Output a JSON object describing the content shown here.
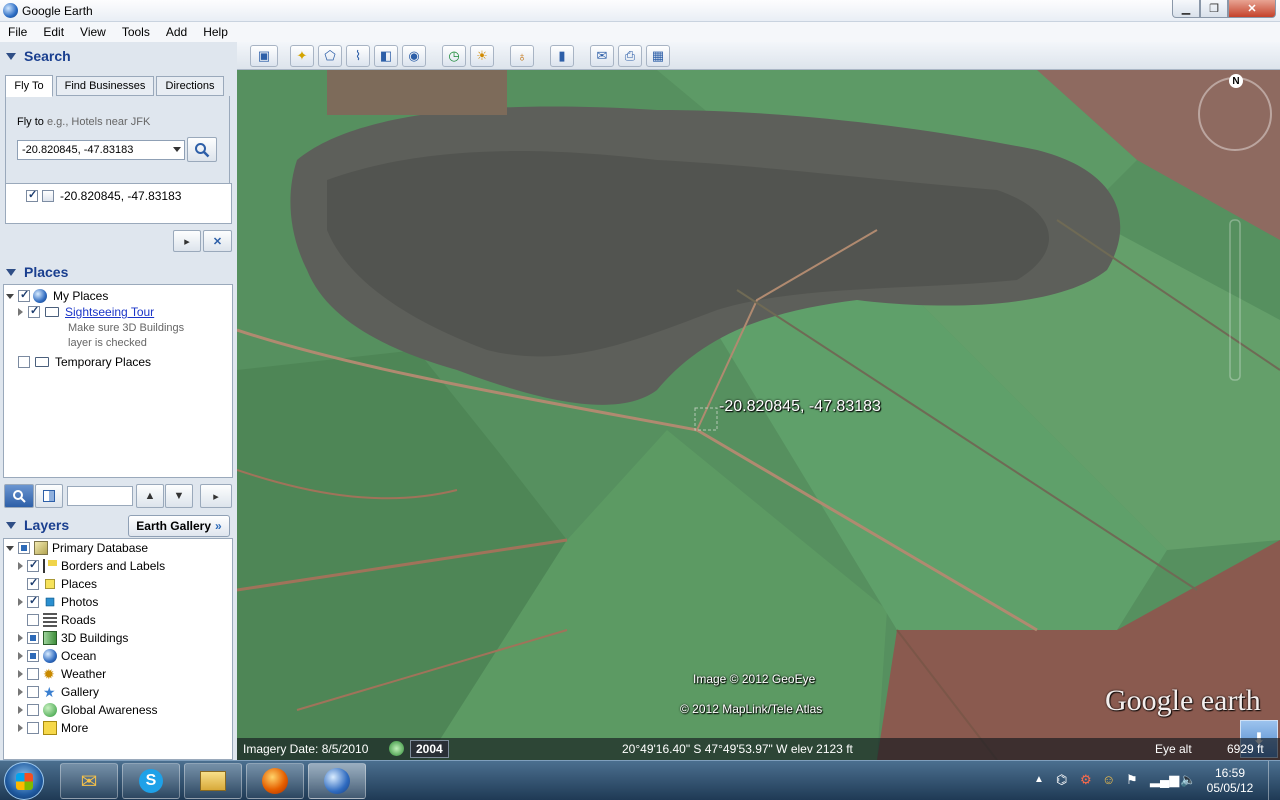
{
  "window": {
    "title": "Google Earth"
  },
  "menu": [
    "File",
    "Edit",
    "View",
    "Tools",
    "Add",
    "Help"
  ],
  "search": {
    "header": "Search",
    "tabs": [
      "Fly To",
      "Find Businesses",
      "Directions"
    ],
    "fly_to_label": "Fly to",
    "fly_to_hint": "e.g., Hotels near JFK",
    "input_value": "-20.820845, -47.83183",
    "result": "-20.820845, -47.83183"
  },
  "places": {
    "header": "Places",
    "my_places": "My Places",
    "sightseeing": "Sightseeing Tour",
    "sightseeing_note_1": "Make sure 3D Buildings",
    "sightseeing_note_2": "layer is checked",
    "temporary": "Temporary Places"
  },
  "layers": {
    "header": "Layers",
    "gallery_button": "Earth Gallery",
    "items": [
      "Primary Database",
      "Borders and Labels",
      "Places",
      "Photos",
      "Roads",
      "3D Buildings",
      "Ocean",
      "Weather",
      "Gallery",
      "Global Awareness",
      "More"
    ]
  },
  "map": {
    "placemark_label": "-20.820845, -47.83183",
    "copyright_1": "Image © 2012 GeoEye",
    "copyright_2": "© 2012 MapLink/Tele Atlas",
    "logo": "Google earth",
    "north": "N",
    "imagery_date": "Imagery Date: 8/5/2010",
    "history_year": "2004",
    "coords": "20°49'16.40\" S  47°49'53.97\" W  elev  2123 ft",
    "eye_alt_label": "Eye alt",
    "eye_alt_value": "6929 ft"
  },
  "taskbar": {
    "time": "16:59",
    "date": "05/05/12"
  }
}
